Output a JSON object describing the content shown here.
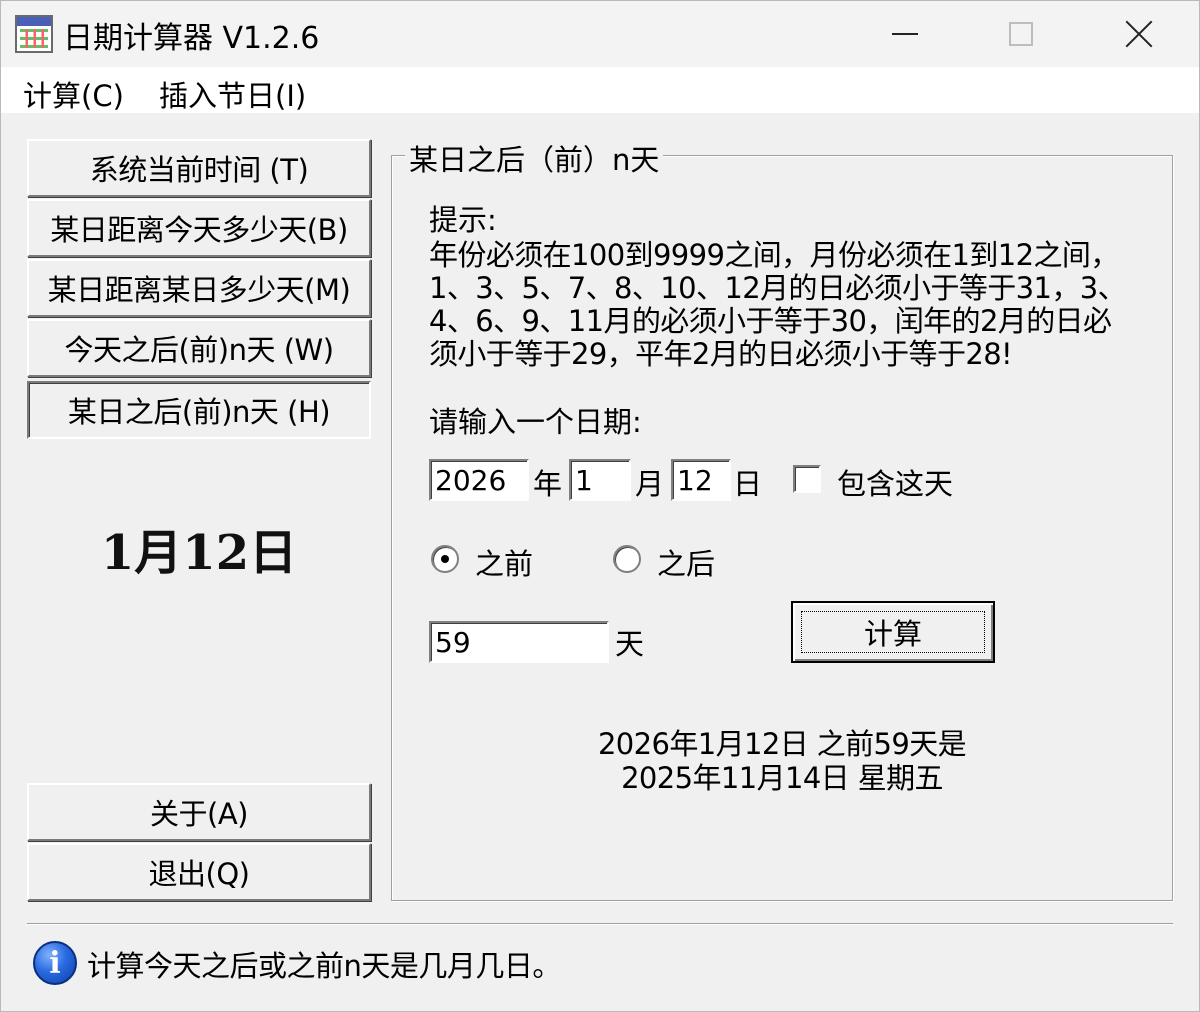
{
  "window": {
    "title": "日期计算器  V1.2.6"
  },
  "menu": {
    "items": [
      "计算(C)",
      "插入节日(I)"
    ]
  },
  "sidebar": {
    "buttons": [
      {
        "label": "系统当前时间    (T)"
      },
      {
        "label": "某日距离今天多少天(B)"
      },
      {
        "label": "某日距离某日多少天(M)"
      },
      {
        "label": "今天之后(前)n天   (W)"
      },
      {
        "label": "某日之后(前)n天   (H)",
        "selected": true
      }
    ],
    "date_display": "1月12日",
    "about_label": "关于(A)",
    "exit_label": "退出(Q)"
  },
  "panel": {
    "group_title": "某日之后（前）n天",
    "hint_title": "提示:",
    "hint_lines": [
      "年份必须在100到9999之间，月份必须在1到12之间，",
      "1、3、5、7、8、10、12月的日必须小于等于31，3、",
      "4、6、9、11月的必须小于等于30，闰年的2月的日必",
      "须小于等于29，平年2月的日必须小于等于28!"
    ],
    "date_prompt": "请输入一个日期:",
    "year_value": "2026",
    "year_unit": "年",
    "month_value": "1",
    "month_unit": "月",
    "day_value": "12",
    "day_unit": "日",
    "include_day_label": "包含这天",
    "include_day_checked": false,
    "radio_before_label": "之前",
    "radio_after_label": "之后",
    "selected_direction": "before",
    "days_value": "59",
    "days_unit": "天",
    "calc_button": "计算",
    "result_line1": "2026年1月12日  之前59天是",
    "result_line2": "2025年11月14日  星期五"
  },
  "status": {
    "icon": "info-icon",
    "text": "计算今天之后或之前n天是几月几日。"
  }
}
